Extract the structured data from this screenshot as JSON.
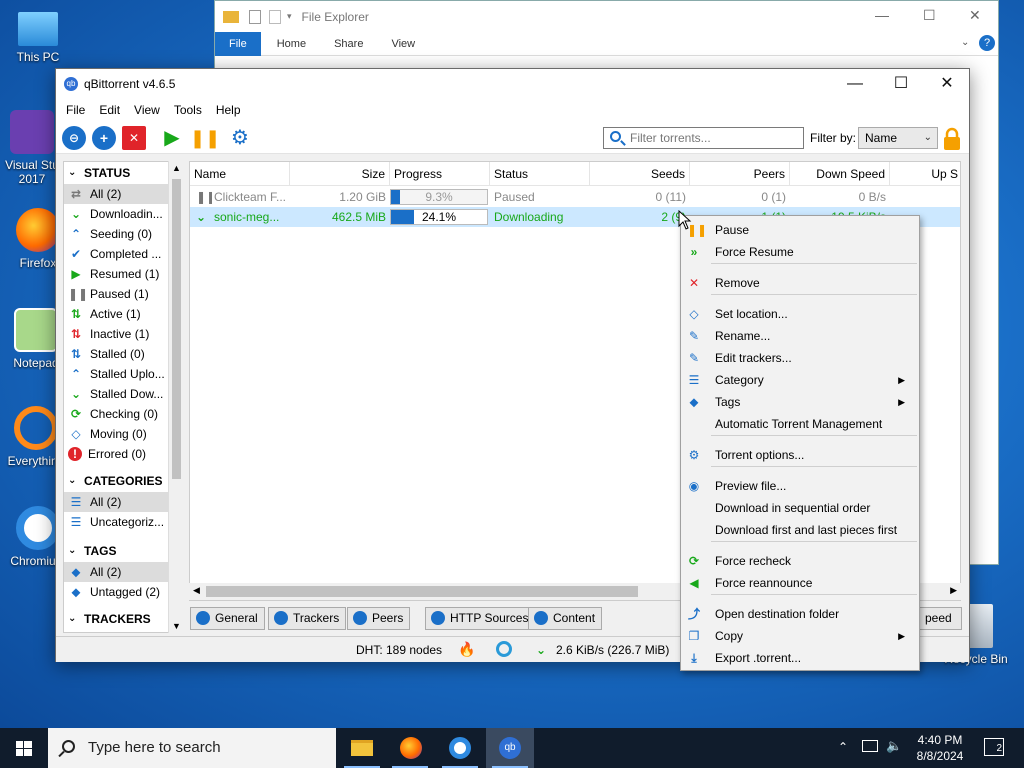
{
  "desktop": {
    "icons": [
      {
        "label": "This PC"
      },
      {
        "label": "Visual Studio 2017",
        "line1": "Visual Stu",
        "line2": "2017"
      },
      {
        "label": "Firefox"
      },
      {
        "label": "Notepad"
      },
      {
        "label": "Everything"
      },
      {
        "label": "Chromium"
      },
      {
        "label": "Recycle Bin"
      }
    ]
  },
  "explorer": {
    "title": "File Explorer",
    "ribbon": [
      "File",
      "Home",
      "Share",
      "View"
    ]
  },
  "qbt": {
    "title": "qBittorrent v4.6.5",
    "menu": [
      "File",
      "Edit",
      "View",
      "Tools",
      "Help"
    ],
    "filter_placeholder": "Filter torrents...",
    "filter_by_label": "Filter by:",
    "filter_by_value": "Name",
    "sidebar": {
      "status_title": "STATUS",
      "status_items": [
        {
          "label": "All (2)",
          "icon": "all-icon",
          "selected": true
        },
        {
          "label": "Downloadin...",
          "icon": "downloading-icon"
        },
        {
          "label": "Seeding (0)",
          "icon": "seeding-icon"
        },
        {
          "label": "Completed ...",
          "icon": "completed-icon"
        },
        {
          "label": "Resumed (1)",
          "icon": "resumed-icon"
        },
        {
          "label": "Paused (1)",
          "icon": "paused-icon"
        },
        {
          "label": "Active (1)",
          "icon": "active-icon"
        },
        {
          "label": "Inactive (1)",
          "icon": "inactive-icon"
        },
        {
          "label": "Stalled (0)",
          "icon": "stalled-icon"
        },
        {
          "label": "Stalled Uplo...",
          "icon": "stalled-upload-icon"
        },
        {
          "label": "Stalled Dow...",
          "icon": "stalled-download-icon"
        },
        {
          "label": "Checking (0)",
          "icon": "checking-icon"
        },
        {
          "label": "Moving (0)",
          "icon": "moving-icon"
        },
        {
          "label": "Errored (0)",
          "icon": "errored-icon"
        }
      ],
      "categories_title": "CATEGORIES",
      "category_items": [
        {
          "label": "All (2)",
          "selected": true
        },
        {
          "label": "Uncategoriz..."
        }
      ],
      "tags_title": "TAGS",
      "tag_items": [
        {
          "label": "All (2)",
          "selected": true
        },
        {
          "label": "Untagged (2)"
        }
      ],
      "trackers_title": "TRACKERS"
    },
    "table": {
      "columns": [
        "Name",
        "Size",
        "Progress",
        "Status",
        "Seeds",
        "Peers",
        "Down Speed",
        "Up S"
      ],
      "rows": [
        {
          "name": "Clickteam F...",
          "size": "1.20 GiB",
          "progress_text": "9.3%",
          "progress": 0.093,
          "status": "Paused",
          "seeds": "0 (11)",
          "peers": "0 (1)",
          "down": "0 B/s"
        },
        {
          "name": "sonic-meg...",
          "size": "462.5 MiB",
          "progress_text": "24.1%",
          "progress": 0.241,
          "status": "Downloading",
          "seeds": "2 (9)",
          "peers": "1 (1)",
          "down": "19.5 KiB/s"
        }
      ]
    },
    "tabs": [
      "General",
      "Trackers",
      "Peers",
      "HTTP Sources",
      "Content",
      "Speed"
    ],
    "tab_speed_visible": "peed",
    "statusbar": {
      "dht": "DHT: 189 nodes",
      "down": "2.6 KiB/s (226.7 MiB)"
    }
  },
  "context_menu": {
    "items": [
      {
        "label": "Pause",
        "icon": "pause-icon"
      },
      {
        "label": "Force Resume",
        "icon": "force-resume-icon"
      },
      {
        "label": "Remove",
        "icon": "remove-icon"
      },
      {
        "label": "Set location...",
        "icon": "set-location-icon"
      },
      {
        "label": "Rename...",
        "icon": "rename-icon"
      },
      {
        "label": "Edit trackers...",
        "icon": "edit-trackers-icon"
      },
      {
        "label": "Category",
        "icon": "category-icon",
        "submenu": true
      },
      {
        "label": "Tags",
        "icon": "tags-icon",
        "submenu": true
      },
      {
        "label": "Automatic Torrent Management",
        "icon": ""
      },
      {
        "label": "Torrent options...",
        "icon": "torrent-options-icon"
      },
      {
        "label": "Preview file...",
        "icon": "preview-icon"
      },
      {
        "label": "Download in sequential order",
        "icon": ""
      },
      {
        "label": "Download first and last pieces first",
        "icon": ""
      },
      {
        "label": "Force recheck",
        "icon": "force-recheck-icon"
      },
      {
        "label": "Force reannounce",
        "icon": "force-reannounce-icon"
      },
      {
        "label": "Open destination folder",
        "icon": "open-folder-icon"
      },
      {
        "label": "Copy",
        "icon": "copy-icon",
        "submenu": true
      },
      {
        "label": "Export .torrent...",
        "icon": "export-icon"
      }
    ],
    "submenu_arrow": "▶"
  },
  "taskbar": {
    "search_placeholder": "Type here to search",
    "time": "4:40 PM",
    "date": "8/8/2024",
    "notifications": "2"
  },
  "colors": {
    "accent": "#1a6fc8",
    "green": "#18a81a",
    "red": "#e0242a",
    "orange": "#f5a000",
    "selection": "#cce8ff"
  }
}
